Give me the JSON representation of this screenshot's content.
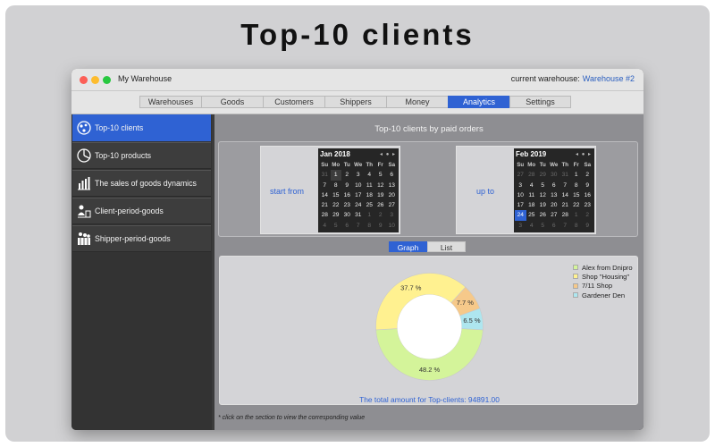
{
  "hero_title": "Top-10 clients",
  "window": {
    "title": "My Warehouse",
    "current_warehouse_label": "current warehouse:",
    "current_warehouse_value": "Warehouse #2"
  },
  "tabs": [
    "Warehouses",
    "Goods",
    "Customers",
    "Shippers",
    "Money",
    "Analytics",
    "Settings"
  ],
  "active_tab": "Analytics",
  "sidebar": [
    {
      "label": "Top-10 clients",
      "icon": "clients-chart-icon",
      "active": true
    },
    {
      "label": "Top-10 products",
      "icon": "pie-chart-icon",
      "active": false
    },
    {
      "label": "The sales of goods dynamics",
      "icon": "bar-chart-icon",
      "active": false
    },
    {
      "label": "Client-period-goods",
      "icon": "client-period-icon",
      "active": false
    },
    {
      "label": "Shipper-period-goods",
      "icon": "shipper-icon",
      "active": false
    }
  ],
  "content_title": "Top-10 clients by paid orders",
  "start": {
    "label": "start from",
    "month": "Jan 2018",
    "weekdays": [
      "Su",
      "Mo",
      "Tu",
      "We",
      "Th",
      "Fr",
      "Sa"
    ],
    "days": [
      [
        "31",
        "1",
        "2",
        "3",
        "4",
        "5",
        "6"
      ],
      [
        "7",
        "8",
        "9",
        "10",
        "11",
        "12",
        "13"
      ],
      [
        "14",
        "15",
        "16",
        "17",
        "18",
        "19",
        "20"
      ],
      [
        "21",
        "22",
        "23",
        "24",
        "25",
        "26",
        "27"
      ],
      [
        "28",
        "29",
        "30",
        "31",
        "1",
        "2",
        "3"
      ],
      [
        "4",
        "5",
        "6",
        "7",
        "8",
        "9",
        "10"
      ]
    ],
    "selected": "1"
  },
  "end": {
    "label": "up to",
    "month": "Feb 2019",
    "weekdays": [
      "Su",
      "Mo",
      "Tu",
      "We",
      "Th",
      "Fr",
      "Sa"
    ],
    "days": [
      [
        "27",
        "28",
        "29",
        "30",
        "31",
        "1",
        "2"
      ],
      [
        "3",
        "4",
        "5",
        "6",
        "7",
        "8",
        "9"
      ],
      [
        "10",
        "11",
        "12",
        "13",
        "14",
        "15",
        "16"
      ],
      [
        "17",
        "18",
        "19",
        "20",
        "21",
        "22",
        "23"
      ],
      [
        "24",
        "25",
        "26",
        "27",
        "28",
        "1",
        "2"
      ],
      [
        "3",
        "4",
        "5",
        "6",
        "7",
        "8",
        "9"
      ]
    ],
    "selected": "24"
  },
  "views": [
    "Graph",
    "List"
  ],
  "active_view": "Graph",
  "chart_data": {
    "type": "pie",
    "categories": [
      "Alex from Dnipro",
      "Shop \"Housing\"",
      "7/11 Shop",
      "Gardener Den"
    ],
    "values": [
      48.2,
      37.7,
      7.7,
      6.5
    ],
    "labels": [
      "48.2 %",
      "37.7 %",
      "7.7 %",
      "6.5 %"
    ],
    "colors": [
      "#d4f49a",
      "#fff190",
      "#f6c98a",
      "#aee6ef"
    ],
    "legend_position": "top-right"
  },
  "total_text": "The total amount for Top-clients: 94891.00",
  "footnote": "* click on the section to view the corresponding value"
}
